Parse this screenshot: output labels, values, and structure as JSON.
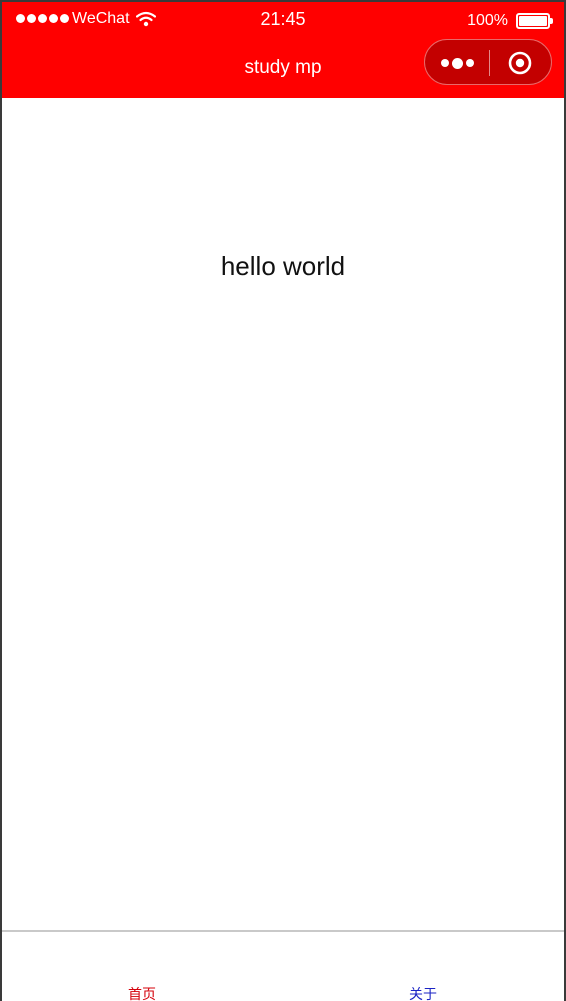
{
  "status_bar": {
    "carrier": "WeChat",
    "time": "21:45",
    "battery": "100%",
    "battery_level": 1.0,
    "signal_icon": "signal-dots-icon",
    "wifi_icon": "wifi-icon",
    "battery_icon": "battery-icon"
  },
  "nav": {
    "title": "study mp",
    "more_icon": "more-dots-icon",
    "close_icon": "target-close-icon"
  },
  "content": {
    "text": "hello world"
  },
  "tabbar": {
    "items": [
      {
        "label": "首页",
        "color": "#d4000a",
        "selected": true
      },
      {
        "label": "关于",
        "color": "#1a23c4",
        "selected": false
      }
    ]
  },
  "colors": {
    "header_bg": "#ff0000",
    "header_text": "#ffffff",
    "capsule_bg": "#c30000",
    "page_bg": "#ffffff",
    "tab_border": "#c9c9c9"
  }
}
